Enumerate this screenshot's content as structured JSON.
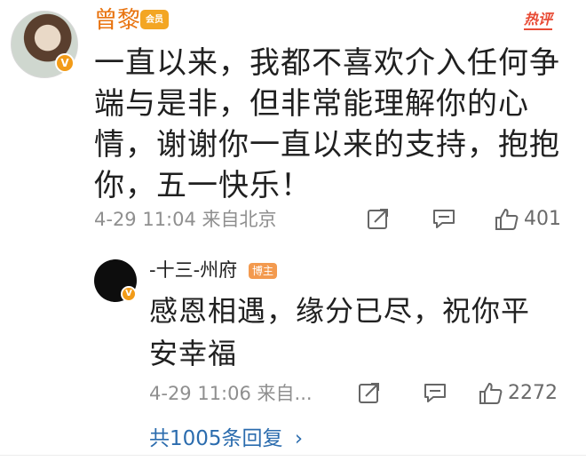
{
  "main_comment": {
    "username": "曾黎",
    "member_badge": "会员",
    "hot_label": "热评",
    "text": "一直以来，我都不喜欢介入任何争端与是非，但非常能理解你的心情，谢谢你一直以来的支持，抱抱你，五一快乐！",
    "meta": "4-29 11:04  来自北京",
    "like_count": "401",
    "verified_icon": "v-badge-icon"
  },
  "reply": {
    "username": "-十三-州府",
    "author_tag": "博主",
    "text": "感恩相遇，缘分已尽，祝你平安幸福",
    "meta": "4-29 11:06  来自...",
    "like_count": "2272"
  },
  "more_replies": {
    "label": "共1005条回复",
    "chevron": "›"
  },
  "colors": {
    "username_orange": "#e8730f",
    "hot_red": "#e84b35",
    "link_blue": "#2b6cae",
    "meta_gray": "#8f8f8f"
  }
}
